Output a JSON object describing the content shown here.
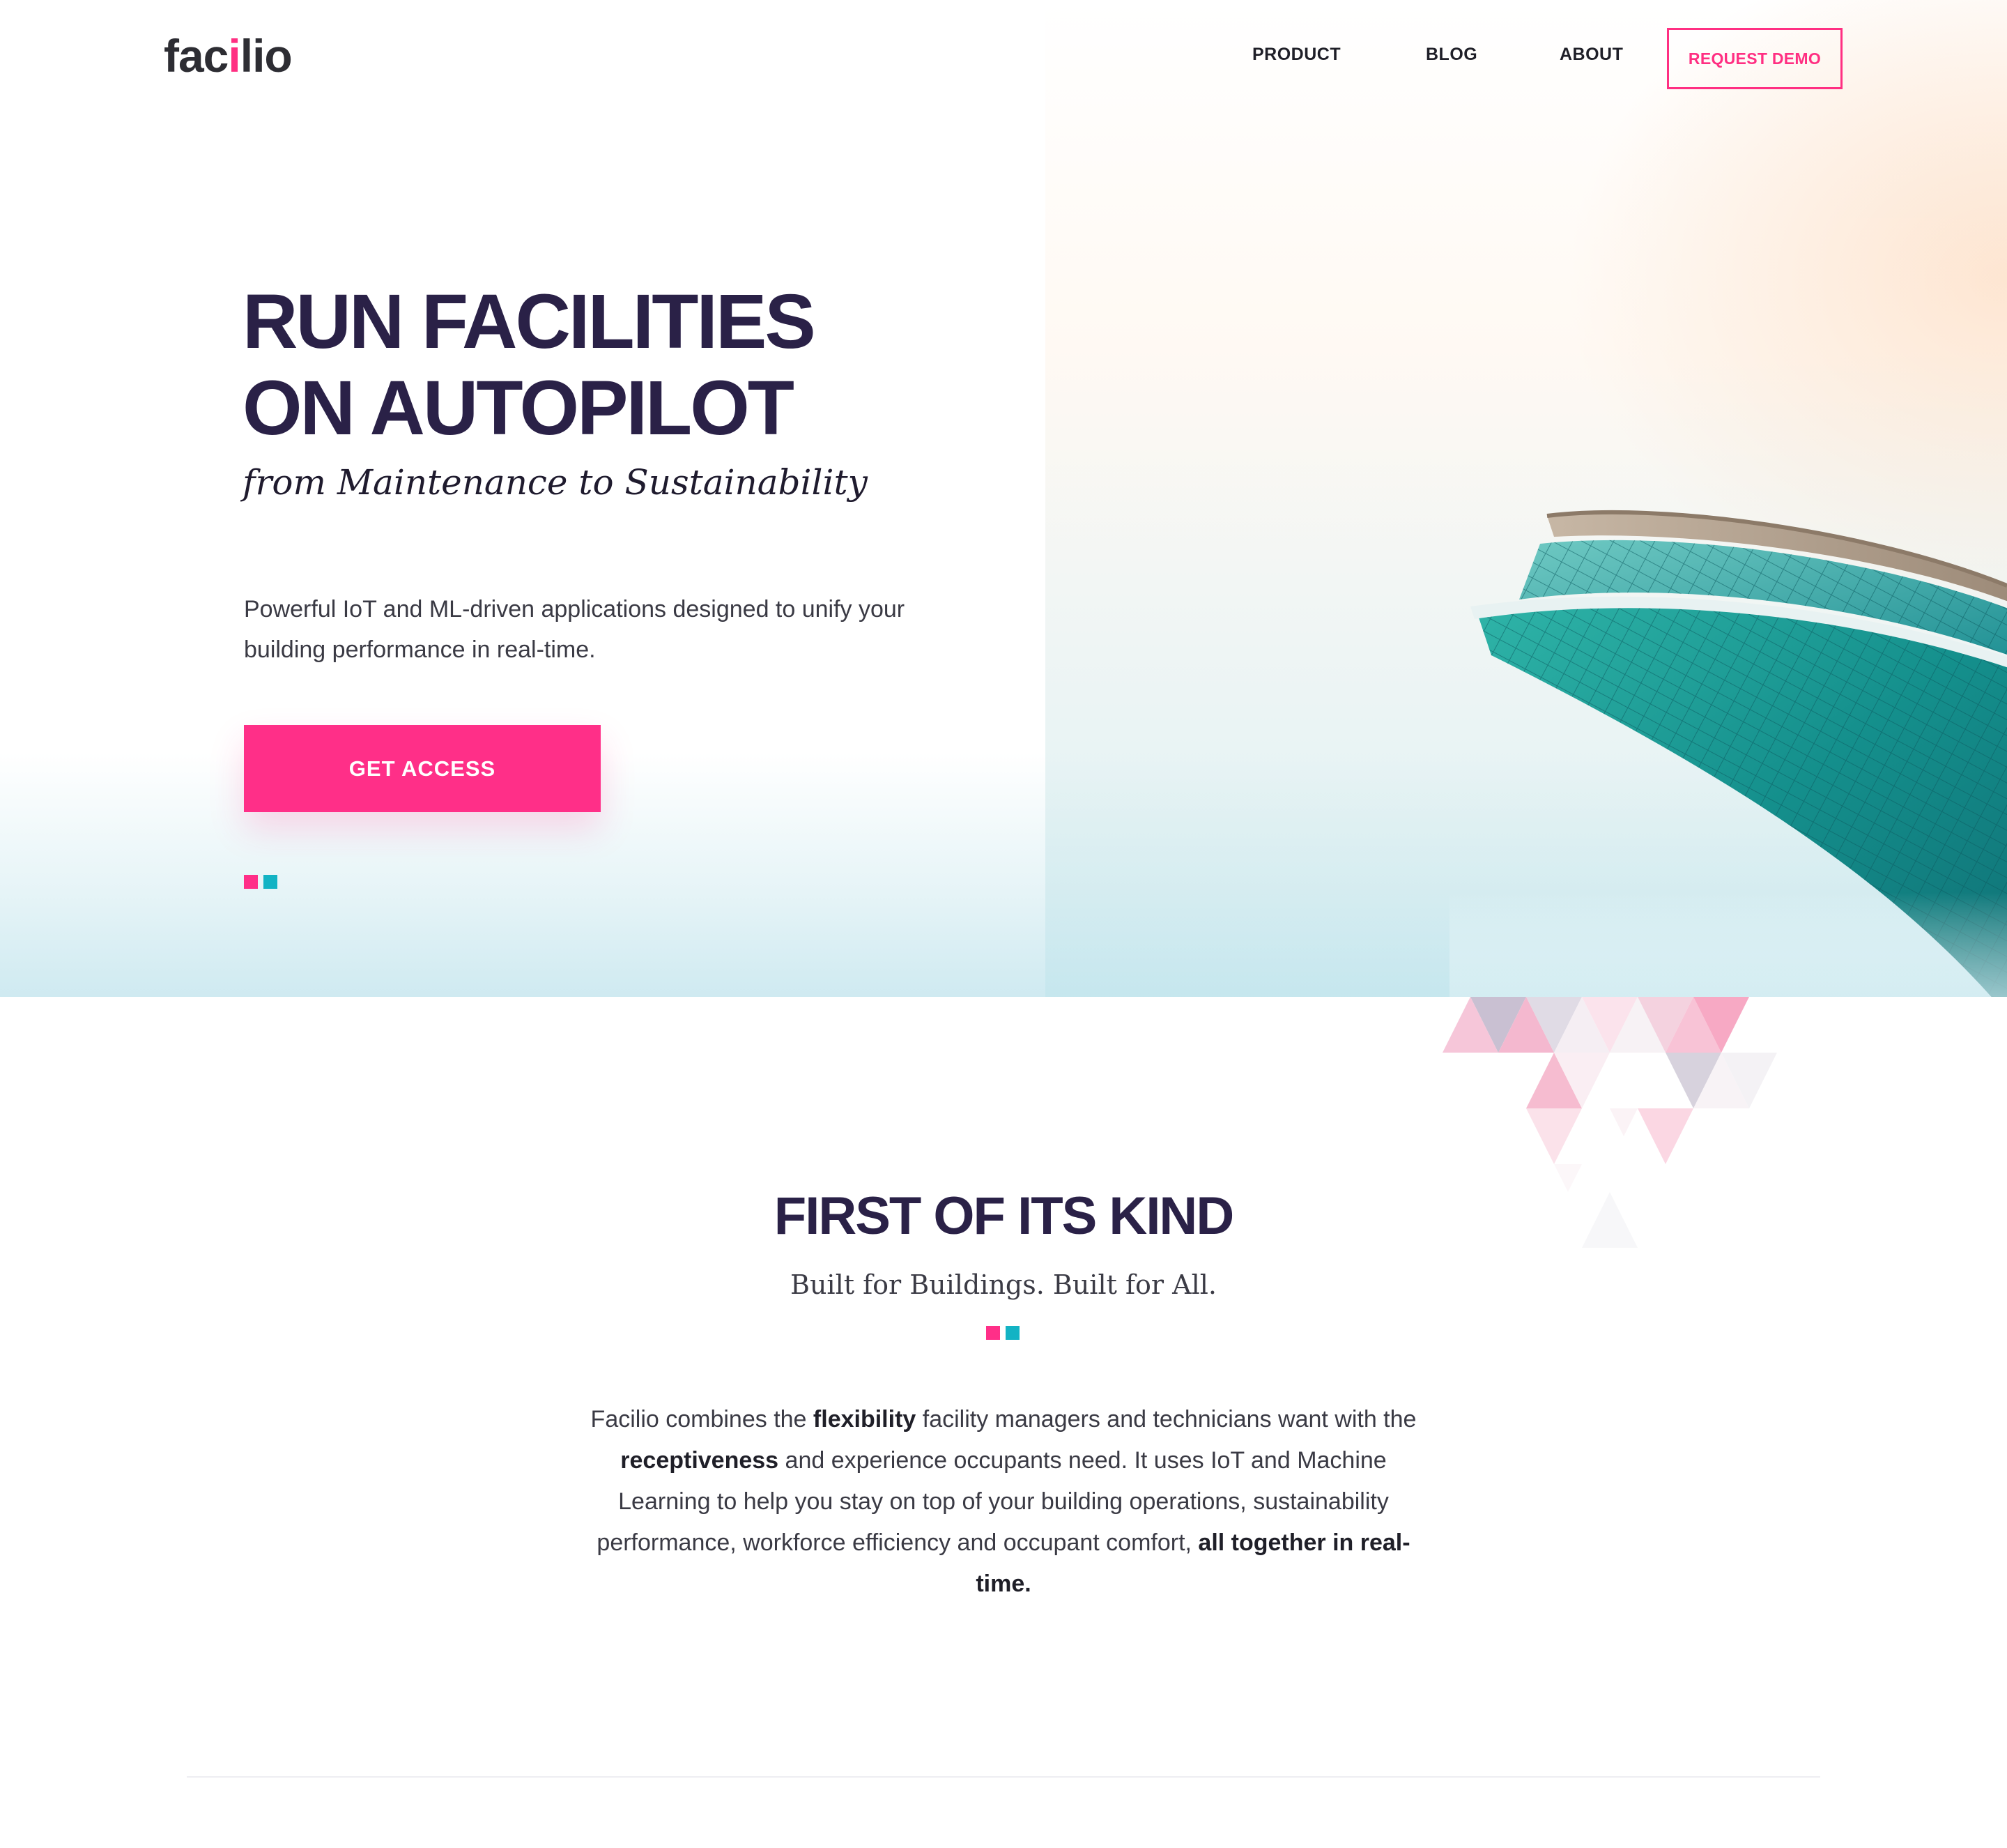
{
  "header": {
    "logo_text_before": "fac",
    "logo_text_dot": "i",
    "logo_text_after": "lio",
    "nav": {
      "product": "PRODUCT",
      "blog": "BLOG",
      "about": "ABOUT"
    },
    "request_demo": "REQUEST DEMO"
  },
  "hero": {
    "title_line1": "RUN FACILITIES",
    "title_line2": "ON AUTOPILOT",
    "subtitle": "from Maintenance to Sustainability",
    "description": "Powerful IoT and ML-driven applications designed to unify your building performance in real-time.",
    "cta": "GET ACCESS"
  },
  "section": {
    "title": "FIRST OF ITS KIND",
    "subtitle": "Built for Buildings. Built for All.",
    "body": {
      "p1": "Facilio combines the ",
      "b1": "flexibility",
      "p2": " facility managers and technicians want with the ",
      "b2": "receptiveness",
      "p3": " and experience occupants need. It uses IoT and Machine Learning to help you stay on top of your building operations, sustainability performance, workforce efficiency and occupant comfort, ",
      "b3": "all together in real-time."
    }
  },
  "colors": {
    "brand_pink": "#ff2f88",
    "brand_teal": "#13b3c4",
    "heading_navy": "#2a2147"
  },
  "icons": {
    "hero_decor": "two-squares-icon",
    "section_decor": "two-squares-icon",
    "building_image": "skyscraper-image",
    "triangle_pattern": "triangle-pattern"
  }
}
